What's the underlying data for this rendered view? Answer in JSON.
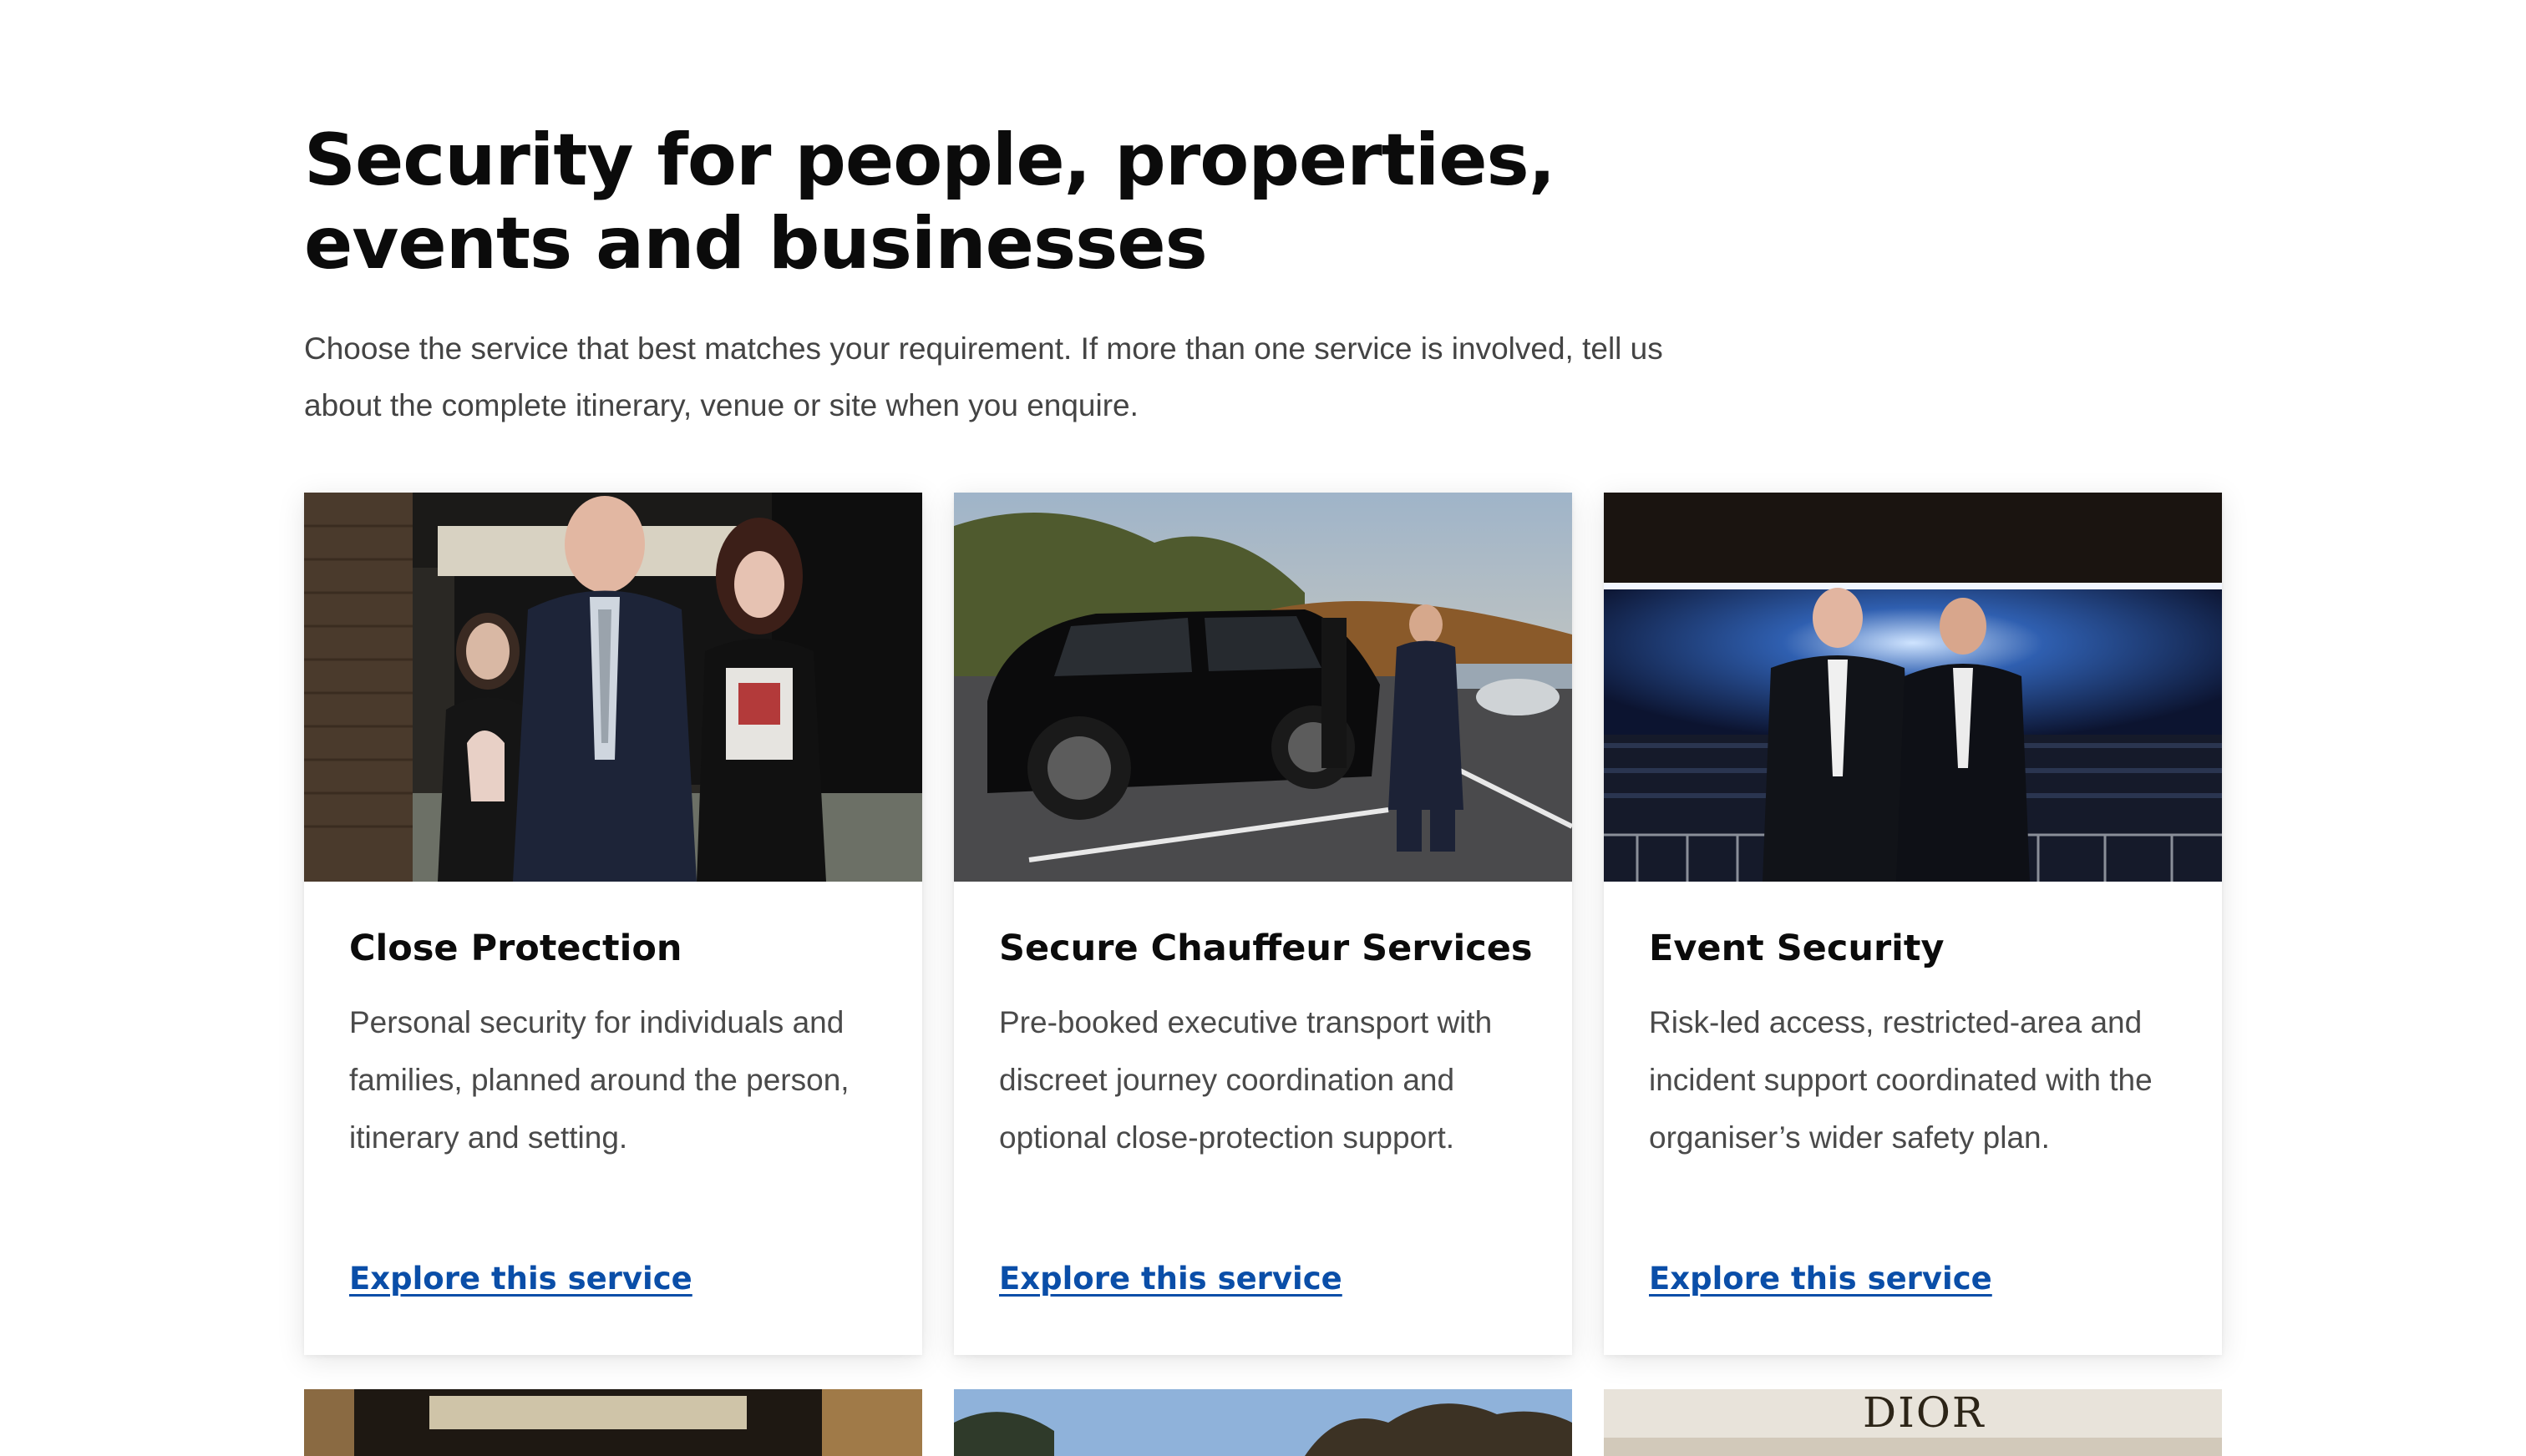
{
  "section": {
    "heading_line1": "Security for people, properties,",
    "heading_line2": "events and businesses",
    "intro": "Choose the service that best matches your requirement. If more than one service is involved, tell us about the complete itinerary, venue or site when you enquire."
  },
  "cards": [
    {
      "title": "Close Protection",
      "text": "Personal security for individuals and families, planned around the person, itinerary and setting.",
      "link": "Explore this service"
    },
    {
      "title": "Secure Chauffeur Services",
      "text": "Pre-booked executive transport with discreet journey coordination and optional close-protection support.",
      "link": "Explore this service"
    },
    {
      "title": "Event Security",
      "text": "Risk-led access, restricted-area and incident support coordinated with the organiser’s wider safety plan.",
      "link": "Explore this service"
    }
  ],
  "next_row": {
    "storefront_sign": "DIOR"
  },
  "colors": {
    "link": "#0a4ea8",
    "heading": "#0b0b0b",
    "body_text": "#4a4a4a"
  }
}
